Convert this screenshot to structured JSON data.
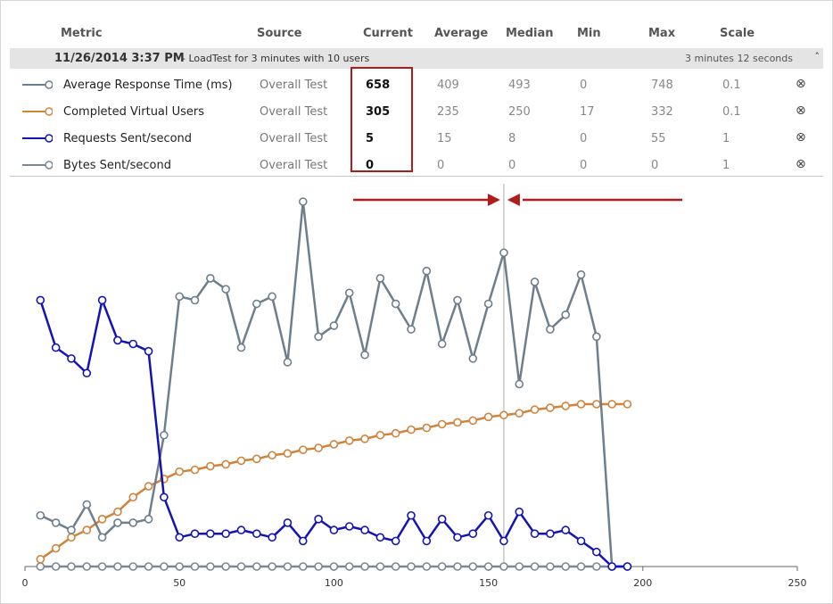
{
  "columns": {
    "metric": "Metric",
    "source": "Source",
    "current": "Current",
    "average": "Average",
    "median": "Median",
    "min": "Min",
    "max": "Max",
    "scale": "Scale"
  },
  "run": {
    "date": "11/26/2014 3:37 PM",
    "description": "- LoadTest for 3 minutes with 10 users",
    "duration": "3 minutes 12 seconds",
    "collapse_icon": "chevron-up-icon"
  },
  "metrics": [
    {
      "name": "Average Response Time (ms)",
      "source": "Overall Test",
      "current": "658",
      "average": "409",
      "median": "493",
      "min": "0",
      "max": "748",
      "scale": "0.1",
      "color": "#6f7e8c"
    },
    {
      "name": "Completed Virtual Users",
      "source": "Overall Test",
      "current": "305",
      "average": "235",
      "median": "250",
      "min": "17",
      "max": "332",
      "scale": "0.1",
      "color": "#cf843e"
    },
    {
      "name": "Requests Sent/second",
      "source": "Overall Test",
      "current": "5",
      "average": "15",
      "median": "8",
      "min": "0",
      "max": "55",
      "scale": "1",
      "color": "#1414b4"
    },
    {
      "name": "Bytes Sent/second",
      "source": "Overall Test",
      "current": "0",
      "average": "0",
      "median": "0",
      "min": "0",
      "max": "0",
      "scale": "1",
      "color": "#7a8794"
    }
  ],
  "remove_icon": "circle-x-icon",
  "annotation": {
    "arrow_color": "#b01c1c",
    "cursor_x": 155
  },
  "chart_data": {
    "type": "line",
    "xlim": [
      0,
      250
    ],
    "xticks": [
      0,
      50,
      100,
      150,
      200,
      250
    ],
    "x_tick_labels": [
      "0",
      "50",
      "100",
      "150",
      "200",
      "250"
    ],
    "ylim": [
      0,
      100
    ],
    "grid": false,
    "x": [
      5,
      10,
      15,
      20,
      25,
      30,
      35,
      40,
      45,
      50,
      55,
      60,
      65,
      70,
      75,
      80,
      85,
      90,
      95,
      100,
      105,
      110,
      115,
      120,
      125,
      130,
      135,
      140,
      145,
      150,
      155,
      160,
      165,
      170,
      175,
      180,
      185,
      190,
      195
    ],
    "series": [
      {
        "name": "Average Response Time (ms)",
        "color": "#6f7e8c",
        "values": [
          14,
          12,
          10,
          17,
          8,
          12,
          12,
          13,
          36,
          74,
          73,
          79,
          76,
          60,
          72,
          74,
          56,
          100,
          63,
          66,
          75,
          58,
          79,
          72,
          65,
          81,
          61,
          73,
          57,
          72,
          86,
          50,
          78,
          65,
          69,
          80,
          63,
          0,
          0
        ]
      },
      {
        "name": "Completed Virtual Users",
        "color": "#cf843e",
        "values": [
          2,
          5,
          8,
          10,
          13,
          15,
          19,
          22,
          24,
          26,
          26.5,
          27.5,
          28,
          29,
          29.5,
          30.5,
          31,
          32,
          32.5,
          33.5,
          34.5,
          35,
          36,
          36.5,
          37.5,
          38,
          39,
          39.5,
          40,
          41,
          41.5,
          42,
          43,
          43.5,
          44,
          44.5,
          44.5,
          44.5,
          44.5
        ]
      },
      {
        "name": "Requests Sent/second",
        "color": "#1414b4",
        "values": [
          73,
          60,
          57,
          53,
          73,
          62,
          61,
          59,
          19,
          8,
          9,
          9,
          9,
          10,
          9,
          8,
          12,
          7,
          13,
          10,
          11,
          10,
          8,
          7,
          14,
          7,
          13,
          8,
          9,
          14,
          7,
          15,
          9,
          9,
          10,
          7,
          4,
          0,
          0
        ]
      },
      {
        "name": "Bytes Sent/second",
        "color": "#7a8794",
        "values": [
          0,
          0,
          0,
          0,
          0,
          0,
          0,
          0,
          0,
          0,
          0,
          0,
          0,
          0,
          0,
          0,
          0,
          0,
          0,
          0,
          0,
          0,
          0,
          0,
          0,
          0,
          0,
          0,
          0,
          0,
          0,
          0,
          0,
          0,
          0,
          0,
          0,
          0,
          0
        ]
      }
    ]
  }
}
